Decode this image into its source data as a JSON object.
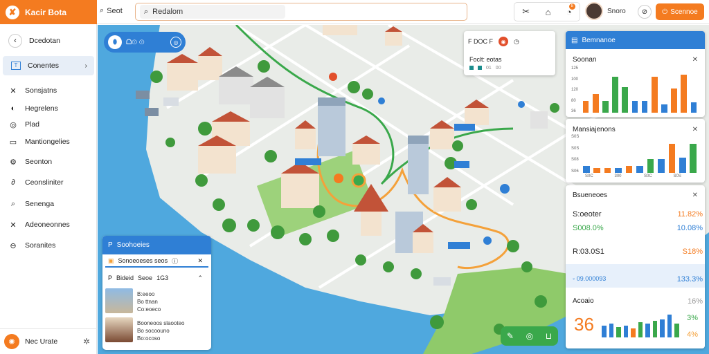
{
  "app": {
    "name": "Kacir Bota",
    "logo_glyph": "✘"
  },
  "topbar": {
    "search_link": "Seot",
    "search_value": "Redalom",
    "profile_name": "Snoro",
    "help_glyph": "⊘",
    "cta_label": "Scennoe",
    "notif_count": "8"
  },
  "sidebar": {
    "items": [
      {
        "label": "Dcedotan",
        "icon": "‹"
      },
      {
        "label": "Conentes",
        "icon": "T"
      },
      {
        "label": "Sonsjatns",
        "icon": "✕"
      },
      {
        "label": "Hegrelens",
        "icon": "◐"
      },
      {
        "label": "Plad",
        "icon": "◎"
      },
      {
        "label": "Mantiongelies",
        "icon": "▭"
      },
      {
        "label": "Seonton",
        "icon": "⚙"
      },
      {
        "label": "Ceonsliniter",
        "icon": "∂"
      },
      {
        "label": "Senenga",
        "icon": "⌕"
      },
      {
        "label": "Adeoneonnes",
        "icon": "✕"
      },
      {
        "label": "Soranites",
        "icon": "⊖"
      }
    ],
    "bottom_label": "Nec Urate"
  },
  "map": {
    "pill_text": "ᗝ⊙ ⊙",
    "info_card": {
      "top_text": "F DOC F",
      "name": "Foclt: eotas",
      "legend": [
        "01",
        "00"
      ]
    },
    "poi_panel": {
      "title": "Soohoeies",
      "row1": "Sonoeoeses seos",
      "row2_a": "Bideid",
      "row2_b": "Seoe",
      "row2_c": "1G3",
      "card1": [
        "B:eeoo",
        "Bo ttnan",
        "Co:eoeco"
      ],
      "card2": [
        "Booneoos slaooteo",
        "Bo socoouno",
        "Bo:ocoso"
      ]
    }
  },
  "panels": {
    "header_title": "Bemnanoe",
    "chart1": {
      "title": "Soonan",
      "yticks": [
        "125",
        "100",
        "120",
        "80",
        "36"
      ]
    },
    "chart2": {
      "title": "Mansiajenons",
      "yticks": [
        "S0S",
        "S0S",
        "S08",
        "S06"
      ],
      "xticks": [
        "S0C",
        "300",
        "S0C",
        "S0S"
      ]
    },
    "stats": {
      "title": "Bsueneoes",
      "rows": [
        {
          "label": "S:oeoter",
          "value": "11.82%"
        },
        {
          "label": "S008.0%",
          "value": "10.08%"
        },
        {
          "label": "R:03.0S1",
          "value": "S18%"
        },
        {
          "label": "◦ 09.000093",
          "value": "133.3%"
        }
      ],
      "footer_label": "Acoaio",
      "footer_values": [
        "16%",
        "3%",
        "4%"
      ],
      "big_number": "36"
    }
  },
  "chart_data": [
    {
      "type": "bar",
      "title": "Soonan",
      "categories": [
        "1",
        "2",
        "3",
        "4",
        "5",
        "6",
        "7",
        "8",
        "9",
        "10",
        "11",
        "12"
      ],
      "series": [
        {
          "values": [
            14,
            22,
            14,
            42,
            30,
            14,
            14,
            42,
            10,
            28,
            44,
            12
          ]
        }
      ],
      "colors": [
        "#f47b20",
        "#f47b20",
        "#3aa84b",
        "#3aa84b",
        "#3aa84b",
        "#2f7fd5",
        "#2f7fd5",
        "#f47b20",
        "#2f7fd5",
        "#f47b20",
        "#f47b20",
        "#2f7fd5"
      ],
      "ylim": [
        0,
        50
      ]
    },
    {
      "type": "bar",
      "title": "Mansiajenons",
      "categories": [
        "1",
        "2",
        "3",
        "4",
        "5",
        "6",
        "7",
        "8",
        "9",
        "10",
        "11"
      ],
      "series": [
        {
          "values": [
            8,
            6,
            6,
            6,
            8,
            8,
            16,
            16,
            34,
            18,
            34
          ]
        }
      ],
      "colors": [
        "#2f7fd5",
        "#f47b20",
        "#f47b20",
        "#2f7fd5",
        "#f47b20",
        "#2f7fd5",
        "#3aa84b",
        "#2f7fd5",
        "#f47b20",
        "#2f7fd5",
        "#3aa84b"
      ],
      "ylim": [
        0,
        40
      ]
    },
    {
      "type": "bar",
      "title": "",
      "categories": [
        "1",
        "2",
        "3",
        "4",
        "5",
        "6",
        "7",
        "8",
        "9",
        "10",
        "11"
      ],
      "series": [
        {
          "values": [
            16,
            18,
            14,
            16,
            12,
            20,
            18,
            22,
            24,
            30,
            18
          ]
        }
      ],
      "colors": [
        "#2f7fd5",
        "#2f7fd5",
        "#3aa84b",
        "#2f7fd5",
        "#f47b20",
        "#3aa84b",
        "#2f7fd5",
        "#3aa84b",
        "#2f7fd5",
        "#2f7fd5",
        "#3aa84b"
      ],
      "ylim": [
        0,
        35
      ]
    }
  ]
}
